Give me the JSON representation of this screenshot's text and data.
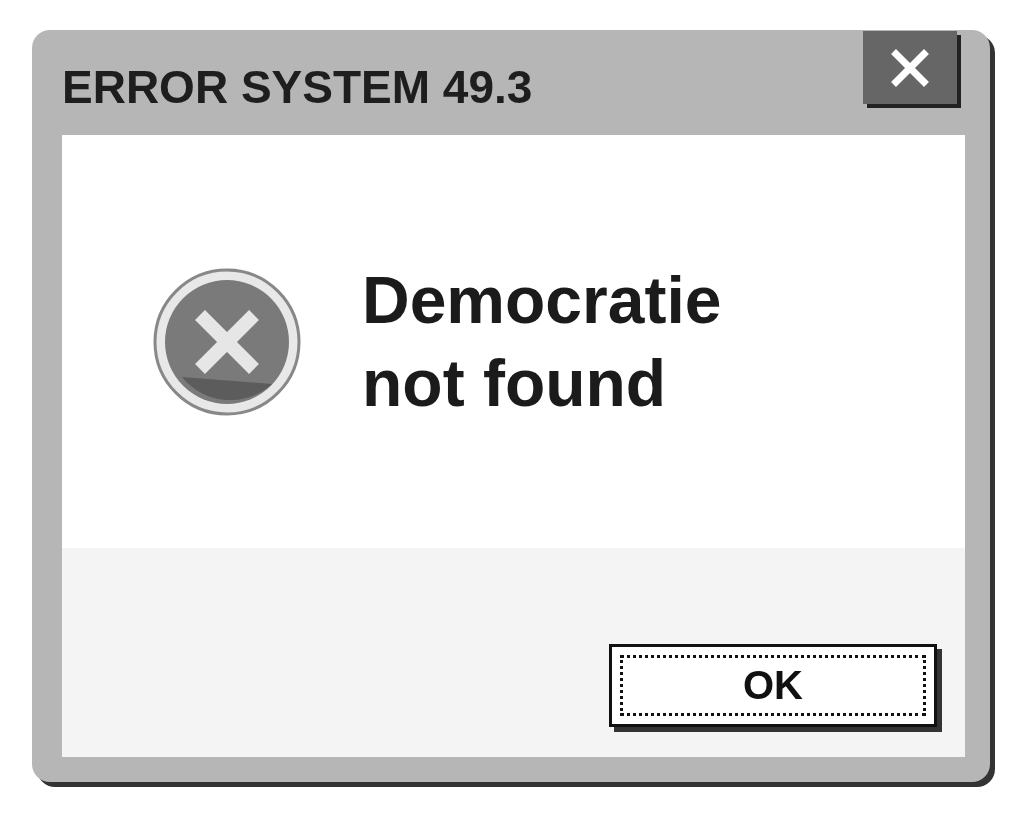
{
  "window": {
    "title": "ERROR SYSTEM 49.3"
  },
  "message": "Democratie not found",
  "buttons": [
    {
      "label": "OK",
      "focused": true
    }
  ]
}
